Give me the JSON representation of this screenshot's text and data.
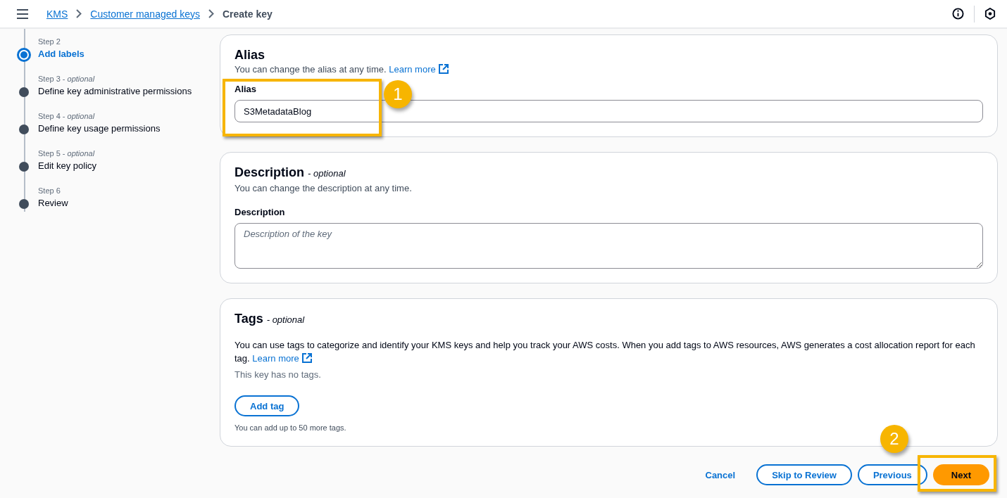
{
  "breadcrumbs": [
    {
      "label": "KMS",
      "kind": "link"
    },
    {
      "label": "Customer managed keys",
      "kind": "link"
    },
    {
      "label": "Create key",
      "kind": "current"
    }
  ],
  "steps": [
    {
      "step": "Step 2",
      "title": "Add labels",
      "selected": true
    },
    {
      "step": "Step 3 - *optional*",
      "title": "Define key administrative permissions",
      "selected": false
    },
    {
      "step": "Step 4 - *optional*",
      "title": "Define key usage permissions",
      "selected": false
    },
    {
      "step": "Step 5 - *optional*",
      "title": "Edit key policy",
      "selected": false
    },
    {
      "step": "Step 6",
      "title": "Review",
      "selected": false
    }
  ],
  "alias_card": {
    "title": "Alias",
    "description": "You can change the alias at any time.",
    "link": "Learn more",
    "field_label": "Alias",
    "value": "S3MetadataBlog"
  },
  "description_card": {
    "title": "Description",
    "note": "- optional",
    "description": "You can change the description at any time.",
    "field_label": "Description",
    "placeholder": "Description of the key"
  },
  "tags_card": {
    "title": "Tags",
    "note": "- optional",
    "text": "You can use tags to categorize and identify your KMS keys and help you track your AWS costs. When you add tags to AWS resources, AWS generates a cost allocation report for each tag.",
    "link": "Learn more",
    "empty": "This key has no tags.",
    "button": "Add tag",
    "hint": "You can add up to 50 more tags."
  },
  "footer_buttons": [
    {
      "label": "Cancel",
      "kind": "link"
    },
    {
      "label": "Skip to Review",
      "kind": "outline"
    },
    {
      "label": "Previous",
      "kind": "outline"
    },
    {
      "label": "Next",
      "kind": "primary"
    }
  ],
  "annotations": [
    {
      "number": "1"
    },
    {
      "number": "2"
    }
  ]
}
